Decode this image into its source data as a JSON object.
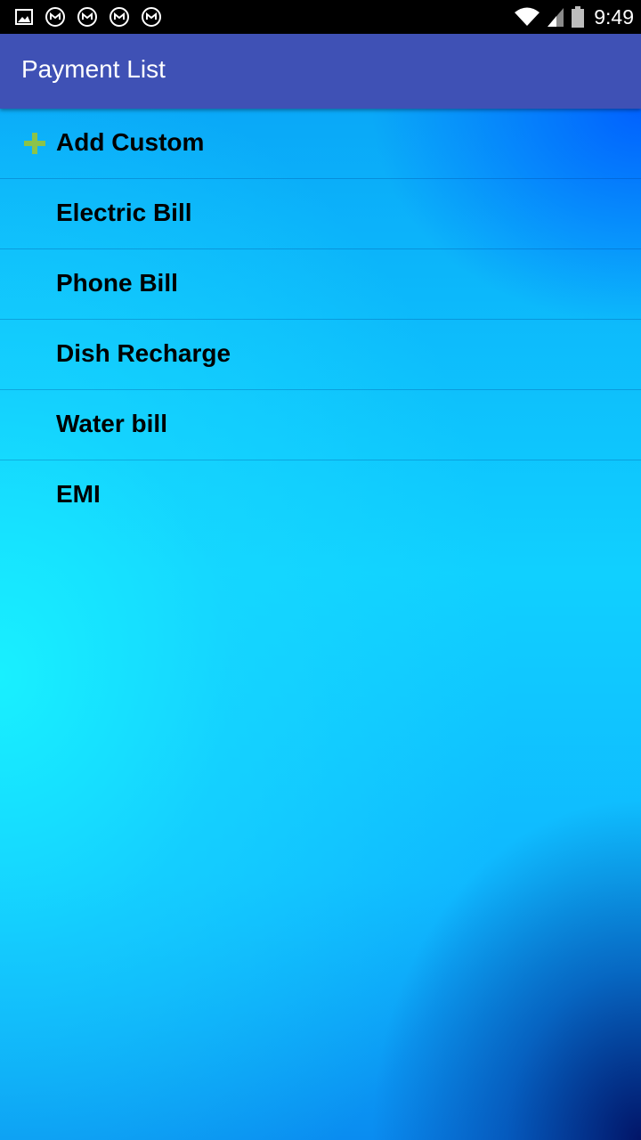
{
  "status_bar": {
    "time": "9:49",
    "left_icons": [
      "image-icon",
      "n-circle-icon",
      "n-circle-icon",
      "n-circle-icon",
      "n-circle-icon"
    ],
    "right_icons": [
      "wifi-icon",
      "signal-icon",
      "battery-icon"
    ]
  },
  "app_bar": {
    "title": "Payment List",
    "color": "#3f51b5"
  },
  "list": {
    "add_custom": {
      "label": "Add Custom",
      "icon": "plus-icon",
      "icon_color": "#8bc34a"
    },
    "items": [
      {
        "label": "Electric Bill"
      },
      {
        "label": "Phone Bill"
      },
      {
        "label": "Dish Recharge"
      },
      {
        "label": "Water bill"
      },
      {
        "label": "EMI"
      }
    ]
  }
}
